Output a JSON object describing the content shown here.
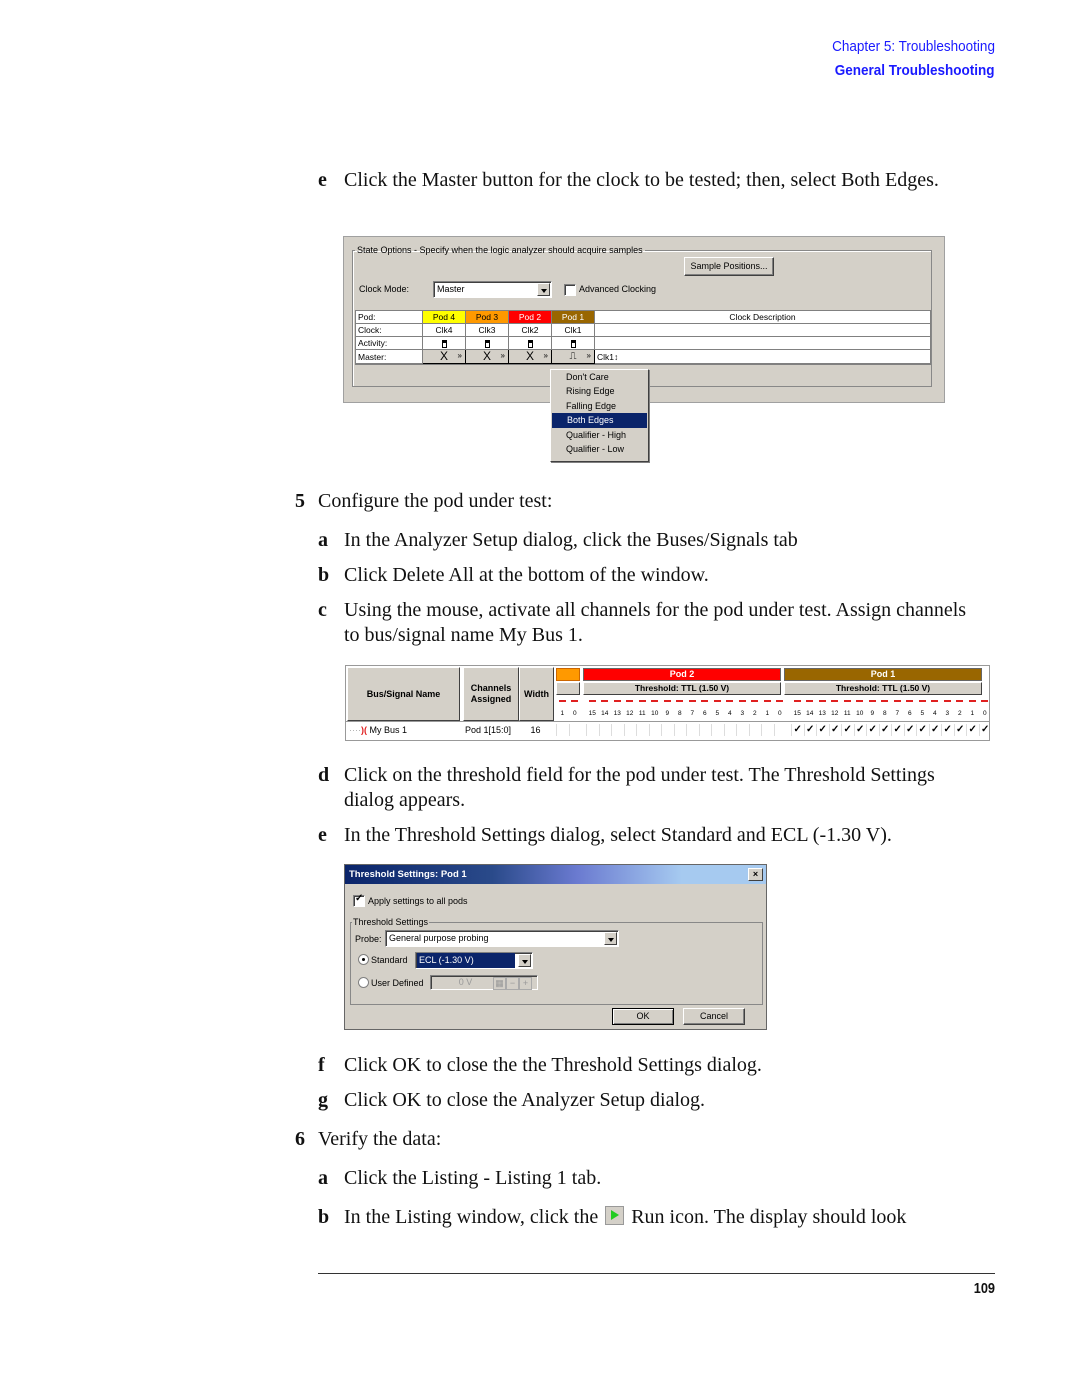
{
  "header": {
    "chapter": "Chapter 5: Troubleshooting",
    "section": "General Troubleshooting"
  },
  "steps": [
    {
      "label": "e",
      "text": "Click the Master button for the clock to be tested; then, select Both Edges."
    },
    {
      "label": "5",
      "text": "Configure the pod under test:"
    },
    {
      "label": "a",
      "text": "In the Analyzer Setup dialog, click the Buses/Signals tab"
    },
    {
      "label": "b",
      "text": "Click Delete All at the bottom of the window."
    },
    {
      "label": "c",
      "text": "Using the mouse, activate all channels for the pod under test. Assign channels to bus/signal name My Bus 1."
    },
    {
      "label": "d",
      "text": "Click on the threshold field for the pod under test. The Threshold Settings dialog appears."
    },
    {
      "label": "e",
      "text": "In the Threshold Settings dialog, select Standard and ECL (-1.30 V)."
    },
    {
      "label": "f",
      "text": "Click OK to close the the Threshold Settings dialog."
    },
    {
      "label": "g",
      "text": "Click OK to close the Analyzer Setup dialog."
    },
    {
      "label": "6",
      "text": "Verify the data:"
    },
    {
      "label": "a",
      "text": "Click the Listing - Listing 1 tab."
    },
    {
      "label": "b",
      "text_before": "In the Listing window, click the",
      "text_after": "Run icon. The display should look"
    }
  ],
  "state_options": {
    "legend": "State Options - Specify when the logic analyzer should acquire samples",
    "sample_positions_button": "Sample Positions...",
    "clock_mode_label": "Clock Mode:",
    "clock_mode_value": "Master",
    "advanced_clocking_label": "Advanced Clocking",
    "advanced_clocking_checked": false,
    "row_labels": [
      "Pod:",
      "Clock:",
      "Activity:",
      "Master:"
    ],
    "clock_description_header": "Clock Description",
    "pods": [
      {
        "name": "Pod 4",
        "clock": "Clk4",
        "color": "#ffff00",
        "text_color": "#000000",
        "master": "X"
      },
      {
        "name": "Pod 3",
        "clock": "Clk3",
        "color": "#ff9900",
        "text_color": "#000000",
        "master": "X"
      },
      {
        "name": "Pod 2",
        "clock": "Clk2",
        "color": "#ff0000",
        "text_color": "#ffffff",
        "master": "X"
      },
      {
        "name": "Pod 1",
        "clock": "Clk1",
        "color": "#996600",
        "text_color": "#ffffff",
        "master": "⎍"
      }
    ],
    "clock_description": "Clk1↕",
    "menu_items": [
      "Don't Care",
      "Rising Edge",
      "Falling Edge",
      "Both Edges",
      "Qualifier - High",
      "Qualifier - Low"
    ],
    "menu_selected": "Both Edges"
  },
  "bus_table": {
    "col_name": "Bus/Signal Name",
    "col_channels": "Channels Assigned",
    "col_width": "Width",
    "pod2": {
      "name": "Pod 2",
      "threshold": "Threshold: TTL (1.50 V)",
      "color": "#ff0000"
    },
    "pod1": {
      "name": "Pod 1",
      "threshold": "Threshold: TTL (1.50 V)",
      "color": "#996600"
    },
    "pod3_partial_color": "#ff9900",
    "pod3_bits": [
      "1",
      "0"
    ],
    "bits": [
      "15",
      "14",
      "13",
      "12",
      "11",
      "10",
      "9",
      "8",
      "7",
      "6",
      "5",
      "4",
      "3",
      "2",
      "1",
      "0"
    ],
    "row": {
      "name": "My Bus 1",
      "channels": "Pod 1[15:0]",
      "width": "16",
      "pod1_checks": "✓"
    }
  },
  "threshold_dialog": {
    "title": "Threshold Settings: Pod 1",
    "close": "×",
    "apply_all_label": "Apply settings to all pods",
    "apply_all_checked": true,
    "group_label": "Threshold Settings",
    "probe_label": "Probe:",
    "probe_value": "General purpose probing",
    "standard_label": "Standard",
    "standard_value": "ECL (-1.30 V)",
    "standard_selected": true,
    "user_defined_label": "User Defined",
    "user_defined_value": "0 V",
    "ok": "OK",
    "cancel": "Cancel"
  },
  "footer": {
    "page_number": "109"
  }
}
